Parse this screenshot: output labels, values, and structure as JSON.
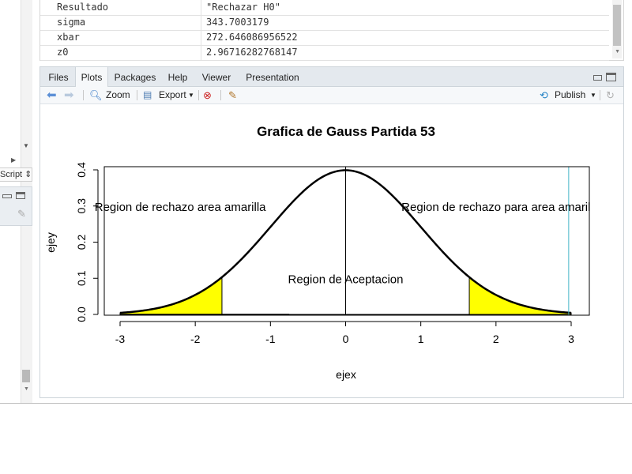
{
  "left_panel": {
    "script_label": "Script ⇕"
  },
  "environment": {
    "rows": [
      {
        "name": "Resultado",
        "value": "\"Rechazar H0\""
      },
      {
        "name": "sigma",
        "value": "343.7003179"
      },
      {
        "name": "xbar",
        "value": "272.646086956522"
      },
      {
        "name": "z0",
        "value": "2.96716282768147"
      }
    ]
  },
  "tabs": [
    {
      "label": "Files",
      "active": false
    },
    {
      "label": "Plots",
      "active": true
    },
    {
      "label": "Packages",
      "active": false
    },
    {
      "label": "Help",
      "active": false
    },
    {
      "label": "Viewer",
      "active": false
    },
    {
      "label": "Presentation",
      "active": false
    }
  ],
  "toolbar": {
    "zoom_label": "Zoom",
    "export_label": "Export",
    "publish_label": "Publish"
  },
  "chart_data": {
    "type": "area",
    "title": "Grafica de Gauss Partida 53",
    "xlabel": "ejex",
    "ylabel": "ejey",
    "xlim": [
      -3,
      3
    ],
    "ylim": [
      0,
      0.4
    ],
    "xticks": [
      "-3",
      "-2",
      "-1",
      "0",
      "1",
      "2",
      "3"
    ],
    "yticks": [
      "0.0",
      "0.1",
      "0.2",
      "0.3",
      "0.4"
    ],
    "series": [
      {
        "curve": "standard normal density",
        "x_range": [
          -3,
          3
        ],
        "color": "#000000"
      }
    ],
    "shaded_regions": [
      {
        "x_from": -3,
        "x_to": -1.645,
        "color": "#ffff00"
      },
      {
        "x_from": 1.645,
        "x_to": 3,
        "color": "#ffff00"
      }
    ],
    "vertical_lines": [
      {
        "x": 0,
        "color": "#000000"
      },
      {
        "x": 2.967,
        "color": "#46b6c8"
      }
    ],
    "annotations": [
      {
        "text": "Region de rechazo area amarilla",
        "x": -2.2,
        "y": 0.3
      },
      {
        "text": "Region de rechazo para area amaril",
        "x": 2.0,
        "y": 0.3
      },
      {
        "text": "Region de Aceptacion",
        "x": 0.0,
        "y": 0.1
      }
    ]
  }
}
